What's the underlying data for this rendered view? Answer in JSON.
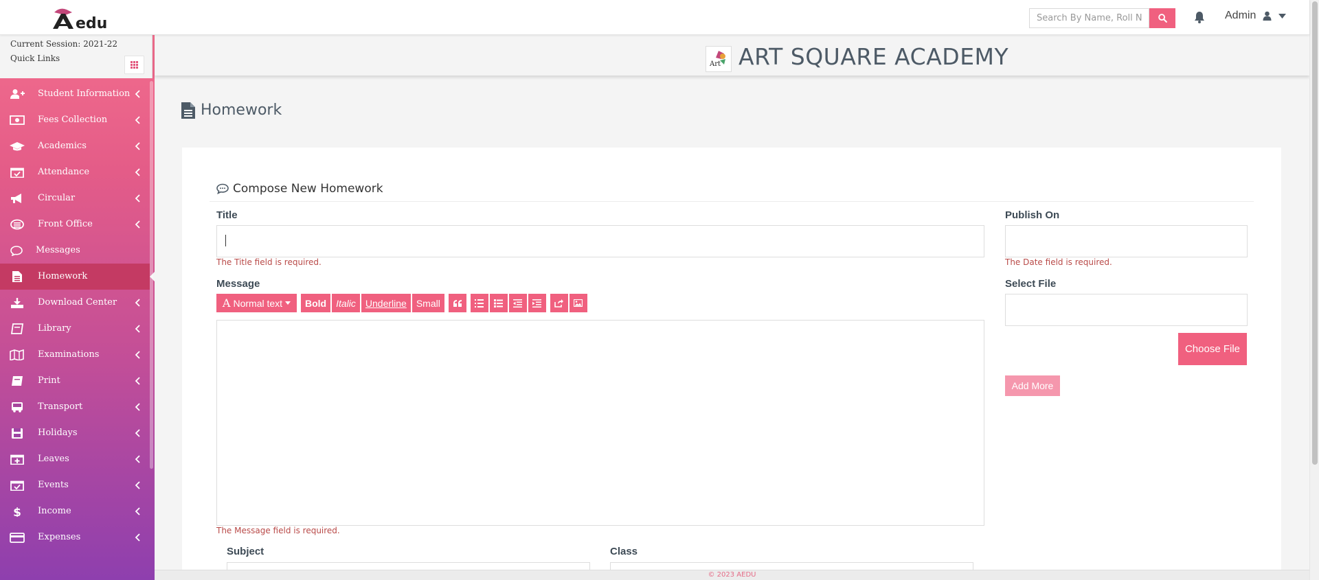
{
  "app": {
    "logo_text": "edu"
  },
  "header": {
    "search_placeholder": "Search By Name, Roll Nu",
    "user_label": "Admin"
  },
  "session": {
    "label": "Current Session: 2021-22",
    "quick_links": "Quick Links"
  },
  "sidebar": {
    "items": [
      {
        "label": "Student Information",
        "icon": "user-plus-icon",
        "chevron": true,
        "active": false
      },
      {
        "label": "Fees Collection",
        "icon": "money-icon",
        "chevron": true,
        "active": false
      },
      {
        "label": "Academics",
        "icon": "graduation-cap-icon",
        "chevron": true,
        "active": false
      },
      {
        "label": "Attendance",
        "icon": "calendar-check-icon",
        "chevron": true,
        "active": false
      },
      {
        "label": "Circular",
        "icon": "bullhorn-icon",
        "chevron": true,
        "active": false
      },
      {
        "label": "Front Office",
        "icon": "front-office-icon",
        "chevron": true,
        "active": false
      },
      {
        "label": "Messages",
        "icon": "comments-icon",
        "chevron": false,
        "active": false
      },
      {
        "label": "Homework",
        "icon": "file-text-icon",
        "chevron": false,
        "active": true
      },
      {
        "label": "Download Center",
        "icon": "download-icon",
        "chevron": true,
        "active": false
      },
      {
        "label": "Library",
        "icon": "book-icon",
        "chevron": true,
        "active": false
      },
      {
        "label": "Examinations",
        "icon": "map-icon",
        "chevron": true,
        "active": false
      },
      {
        "label": "Print",
        "icon": "print-book-icon",
        "chevron": true,
        "active": false
      },
      {
        "label": "Transport",
        "icon": "bus-icon",
        "chevron": true,
        "active": false
      },
      {
        "label": "Holidays",
        "icon": "save-icon",
        "chevron": true,
        "active": false
      },
      {
        "label": "Leaves",
        "icon": "calendar-plus-icon",
        "chevron": true,
        "active": false
      },
      {
        "label": "Events",
        "icon": "calendar-check-icon",
        "chevron": true,
        "active": false
      },
      {
        "label": "Income",
        "icon": "dollar-icon",
        "chevron": true,
        "active": false
      },
      {
        "label": "Expenses",
        "icon": "credit-card-icon",
        "chevron": true,
        "active": false
      }
    ]
  },
  "banner": {
    "school_name": "ART SQUARE ACADEMY"
  },
  "page": {
    "title": "Homework"
  },
  "form": {
    "heading": "Compose New Homework",
    "title_label": "Title",
    "title_value": "",
    "title_error": "The Title field is required.",
    "publish_label": "Publish On",
    "publish_value": "",
    "date_error": "The Date field is required.",
    "message_label": "Message",
    "message_error": "The Message field is required.",
    "select_file_label": "Select File",
    "choose_file_btn": "Choose File",
    "add_more_btn": "Add More",
    "subject_label": "Subject",
    "class_label": "Class",
    "toolbar": {
      "text_style": "Normal text",
      "bold": "Bold",
      "italic": "Italic",
      "underline": "Underline",
      "small": "Small"
    }
  },
  "footer": {
    "text": "© 2023 AEDU"
  },
  "colors": {
    "accent": "#f0607f",
    "active": "#c43a63",
    "error": "#b94a48"
  }
}
